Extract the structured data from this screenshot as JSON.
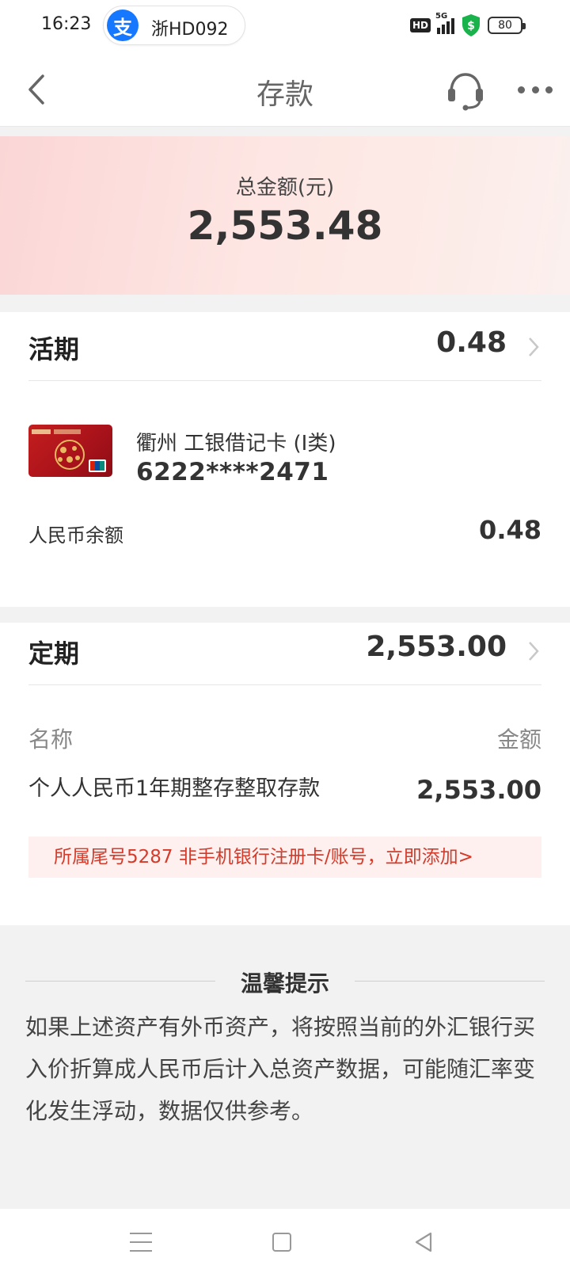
{
  "status_bar": {
    "time": "16:23",
    "alipay_text": "浙HD092",
    "alipay_logo": "支",
    "hd_badge": "HD",
    "network": "5G",
    "battery": "80"
  },
  "nav": {
    "title": "存款",
    "back_icon": "chevron-left-icon",
    "service_icon": "headset-icon",
    "more_icon": "more-dots-icon"
  },
  "total": {
    "label": "总金额(元)",
    "amount": "2,553.48"
  },
  "demand": {
    "title": "活期",
    "amount": "0.48",
    "card_name": "衢州 工银借记卡 (I类)",
    "card_number": "6222****2471",
    "rmb_label": "人民币余额",
    "rmb_value": "0.48"
  },
  "fixed": {
    "title": "定期",
    "amount": "2,553.00",
    "col_name": "名称",
    "col_amount": "金额",
    "product_name": "个人人民币1年期整存整取存款",
    "product_amount": "2,553.00",
    "notice": "所属尾号5287 非手机银行注册卡/账号，立即添加>"
  },
  "tips": {
    "title": "温馨提示",
    "text": "如果上述资产有外币资产，将按照当前的外汇银行买入价折算成人民币后计入总资产数据，可能随汇率变化发生浮动，数据仅供参考。"
  },
  "colors": {
    "accent_red": "#d43b2b",
    "alipay_blue": "#1677ff",
    "banner_pink": "#fbd6d6"
  }
}
